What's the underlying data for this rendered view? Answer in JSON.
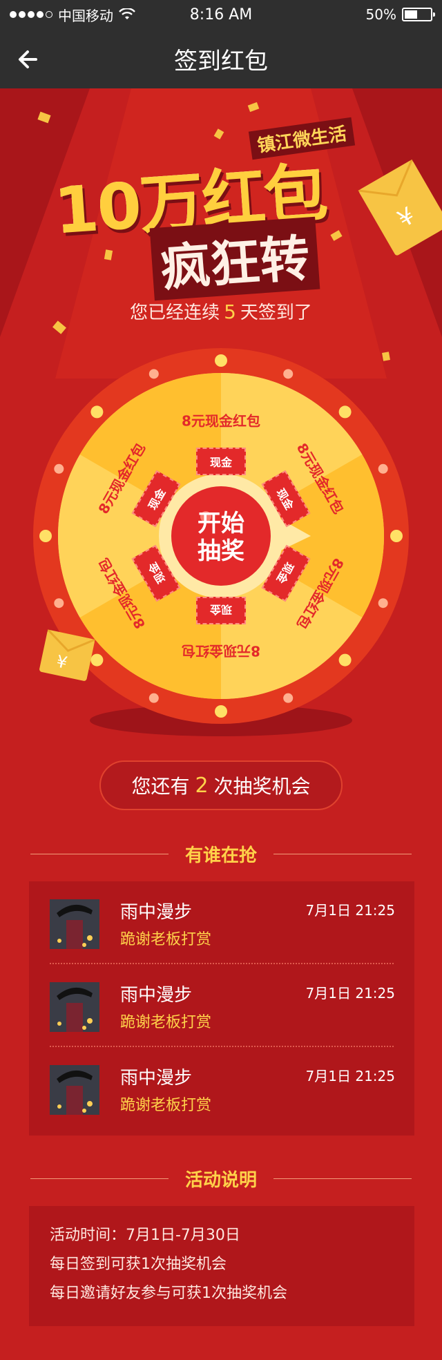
{
  "status_bar": {
    "carrier": "中国移动",
    "time": "8:16 AM",
    "battery": "50%",
    "battery_level": 0.5
  },
  "nav": {
    "title": "签到红包",
    "back_icon": "arrow-left-icon"
  },
  "hero": {
    "brand": "镇江微生活",
    "headline_main": "10万红包",
    "headline_sub": "疯狂转",
    "streak_prefix": "您已经连续",
    "streak_days": "5",
    "streak_suffix": "天签到了"
  },
  "wheel": {
    "center_line1": "开始",
    "center_line2": "抽奖",
    "segment_label": "8元现金红包",
    "ticket_label": "现金",
    "colors": {
      "rim": "#e3381f",
      "light": "#ffd359",
      "dark": "#ffbf2f",
      "ticket": "#e3292a"
    }
  },
  "chances": {
    "prefix": "您还有",
    "count": "2",
    "suffix": "次抽奖机会"
  },
  "winners_section": {
    "title": "有谁在抢",
    "items": [
      {
        "name": "雨中漫步",
        "message": "跪谢老板打赏",
        "time": "7月1日 21:25"
      },
      {
        "name": "雨中漫步",
        "message": "跪谢老板打赏",
        "time": "7月1日 21:25"
      },
      {
        "name": "雨中漫步",
        "message": "跪谢老板打赏",
        "time": "7月1日 21:25"
      }
    ]
  },
  "rules_section": {
    "title": "活动说明",
    "lines": [
      "活动时间：7月1日-7月30日",
      "每日签到可获1次抽奖机会",
      "每日邀请好友参与可获1次抽奖机会"
    ]
  }
}
